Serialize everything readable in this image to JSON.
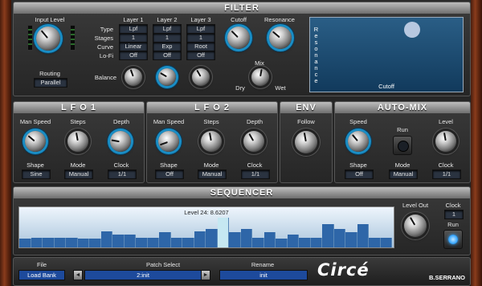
{
  "filter": {
    "title": "FILTER",
    "input_level_label": "Input Level",
    "routing_label": "Routing",
    "routing_value": "Parallel",
    "layer_headers": [
      "Layer 1",
      "Layer 2",
      "Layer 3"
    ],
    "row_labels": [
      "Type",
      "Stages",
      "Curve",
      "Lo-Fi"
    ],
    "layers": [
      {
        "type": "Lpf",
        "stages": "1",
        "curve": "Linear",
        "lofi": "Off"
      },
      {
        "type": "Lpf",
        "stages": "1",
        "curve": "Exp",
        "lofi": "Off"
      },
      {
        "type": "Lpf",
        "stages": "1",
        "curve": "Root",
        "lofi": "Off"
      }
    ],
    "balance_label": "Balance",
    "cutoff_label": "Cutoff",
    "resonance_label": "Resonance",
    "mix_label": "Mix",
    "dry_label": "Dry",
    "wet_label": "Wet",
    "xy_vertical_label": "Resonance",
    "xy_bottom_label": "Cutoff"
  },
  "lfo1": {
    "title": "L F O  1",
    "man_speed_label": "Man Speed",
    "steps_label": "Steps",
    "depth_label": "Depth",
    "shape_label": "Shape",
    "mode_label": "Mode",
    "clock_label": "Clock",
    "shape_value": "Sine",
    "mode_value": "Manual",
    "clock_value": "1/1"
  },
  "lfo2": {
    "title": "L F O  2",
    "man_speed_label": "Man Speed",
    "steps_label": "Steps",
    "depth_label": "Depth",
    "shape_label": "Shape",
    "mode_label": "Mode",
    "clock_label": "Clock",
    "shape_value": "Off",
    "mode_value": "Manual",
    "clock_value": "1/1"
  },
  "env": {
    "title": "ENV",
    "follow_label": "Follow"
  },
  "automix": {
    "title": "AUTO-MIX",
    "speed_label": "Speed",
    "run_label": "Run",
    "level_label": "Level",
    "shape_label": "Shape",
    "mode_label": "Mode",
    "clock_label": "Clock",
    "shape_value": "Off",
    "mode_value": "Manual",
    "clock_value": "1/1"
  },
  "sequencer": {
    "title": "SEQUENCER",
    "readout": "Level 24: 8.6207",
    "level_out_label": "Level Out",
    "clock_label": "Clock",
    "clock_value": "1",
    "run_label": "Run",
    "selected_step": 17,
    "steps": [
      0.22,
      0.24,
      0.24,
      0.26,
      0.24,
      0.22,
      0.22,
      0.42,
      0.34,
      0.34,
      0.24,
      0.24,
      0.4,
      0.24,
      0.24,
      0.42,
      0.48,
      0.78,
      0.4,
      0.48,
      0.24,
      0.4,
      0.22,
      0.34,
      0.24,
      0.24,
      0.6,
      0.48,
      0.4,
      0.6,
      0.24,
      0.24
    ]
  },
  "footer": {
    "file_label": "File",
    "file_value": "Load Bank",
    "patch_label": "Patch Select",
    "patch_value": "2:init",
    "rename_label": "Rename",
    "rename_value": "init",
    "logo": "Circé",
    "brand": "B.SERRANO",
    "prev_arrow": "◄",
    "next_arrow": "►"
  },
  "colors": {
    "accent": "#1a8dc4",
    "combo": "#1d4a9c",
    "seq_bar": "#2e66a8",
    "led": "#3aa8ff"
  }
}
